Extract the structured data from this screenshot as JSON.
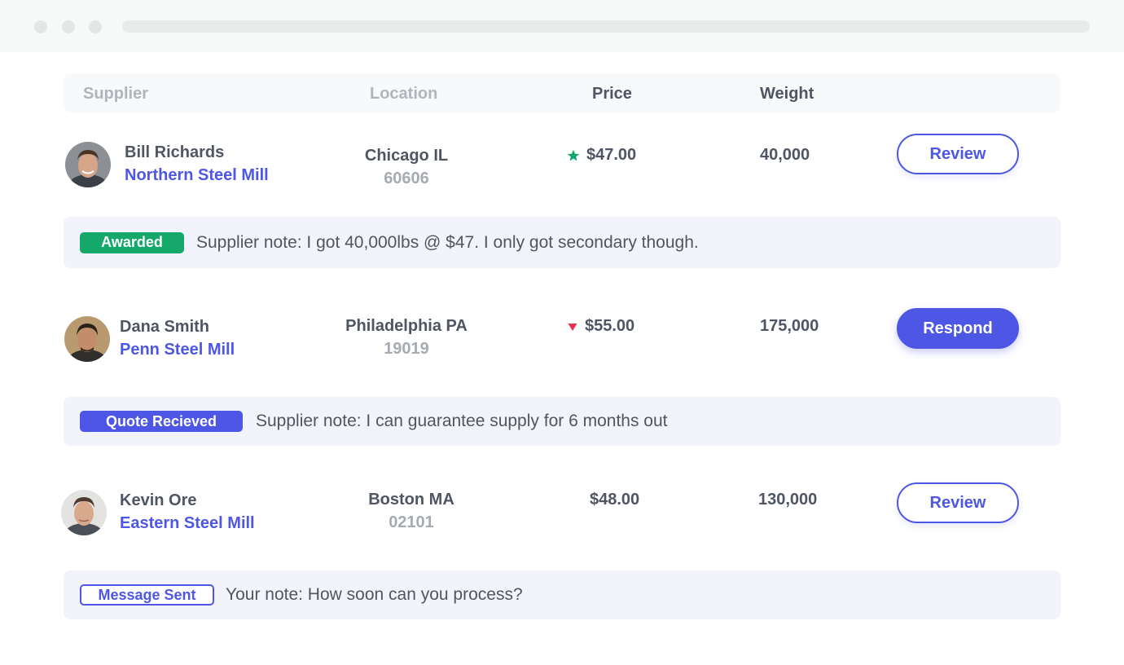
{
  "table": {
    "headers": {
      "supplier": "Supplier",
      "location": "Location",
      "price": "Price",
      "weight": "Weight"
    },
    "rows": [
      {
        "name": "Bill Richards",
        "company": "Northern Steel Mill",
        "city": "Chicago IL",
        "zip": "60606",
        "price": "$47.00",
        "price_indicator": "star-icon",
        "weight": "40,000",
        "action": "Review",
        "status": "Awarded",
        "note": "Supplier note: I got 40,000lbs @ $47. I only got secondary though."
      },
      {
        "name": "Dana Smith",
        "company": "Penn Steel Mill",
        "city": "Philadelphia PA",
        "zip": "19019",
        "price": "$55.00",
        "price_indicator": "down-triangle-icon",
        "weight": "175,000",
        "action": "Respond",
        "status": "Quote Recieved",
        "note": "Supplier note: I can guarantee supply for 6 months out"
      },
      {
        "name": "Kevin Ore",
        "company": "Eastern Steel Mill",
        "city": "Boston MA",
        "zip": "02101",
        "price": "$48.00",
        "price_indicator": "",
        "weight": "130,000",
        "action": "Review",
        "status": "Message Sent",
        "note": "Your note: How soon can you process?"
      }
    ]
  },
  "colors": {
    "accent": "#4e56e6",
    "awarded": "#14a86b",
    "down": "#e8324f",
    "text": "#4f5562",
    "muted": "#a6abb2"
  }
}
